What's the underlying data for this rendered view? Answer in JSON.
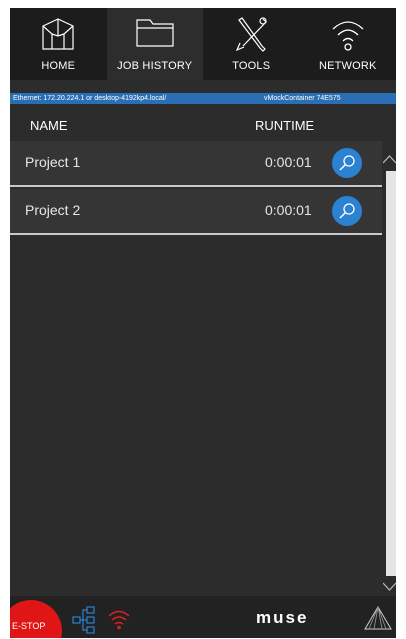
{
  "nav": {
    "tabs": [
      {
        "label": "HOME",
        "icon": "home-icon"
      },
      {
        "label": "JOB HISTORY",
        "icon": "folder-icon",
        "active": true
      },
      {
        "label": "TOOLS",
        "icon": "tools-icon"
      },
      {
        "label": "NETWORK",
        "icon": "network-icon"
      }
    ]
  },
  "status": {
    "left": "Ethernet: 172.20.224.1  or desktop-4192kp4.local/",
    "right": "vMockContainer  74E575"
  },
  "table": {
    "headers": {
      "name": "NAME",
      "runtime": "RUNTIME"
    },
    "rows": [
      {
        "name": "Project 1",
        "runtime": "0:00:01"
      },
      {
        "name": "Project 2",
        "runtime": "0:00:01"
      }
    ]
  },
  "bottom": {
    "estop": "E-STOP",
    "logo": "muse"
  },
  "colors": {
    "accent": "#2a82d0",
    "status_bar": "#2a6fb5",
    "estop": "#e01515",
    "wifi_alert": "#e02020"
  }
}
